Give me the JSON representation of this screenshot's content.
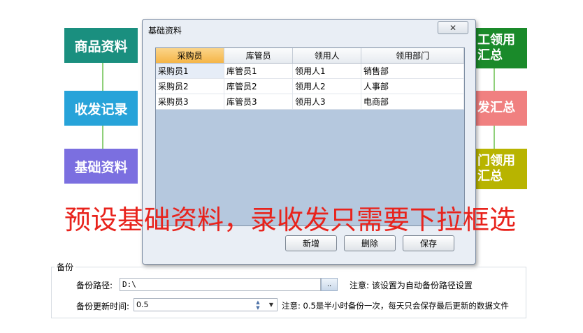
{
  "flow_left": [
    {
      "label": "商品资料",
      "color": "#1a8f7f"
    },
    {
      "label": "收发记录",
      "color": "#27a3d9"
    },
    {
      "label": "基础资料",
      "color": "#7b6fe0"
    }
  ],
  "flow_right": [
    {
      "label": "工领用\n汇总",
      "color": "#1a8a2a"
    },
    {
      "label": "发汇总",
      "color": "#f08080"
    },
    {
      "label": "门领用\n汇总",
      "color": "#b8b400"
    }
  ],
  "dialog": {
    "title": "基础资料",
    "columns": [
      "采购员",
      "库管员",
      "领用人",
      "领用部门"
    ],
    "rows": [
      [
        "采购员1",
        "库管员1",
        "领用人1",
        "销售部"
      ],
      [
        "采购员2",
        "库管员2",
        "领用人2",
        "人事部"
      ],
      [
        "采购员3",
        "库管员3",
        "领用人3",
        "电商部"
      ]
    ],
    "buttons": {
      "add": "新增",
      "delete": "删除",
      "save": "保存"
    }
  },
  "overlay_text": "预设基础资料，录收发只需要下拉框选",
  "backup": {
    "legend": "备份",
    "path_label": "备份路径:",
    "path_value": "D:\\",
    "browse_label": "..",
    "path_note": "注意: 该设置为自动备份路径设置",
    "interval_label": "备份更新时间:",
    "interval_value": "0.5",
    "interval_note": "注意: 0.5是半小时备份一次，每天只会保存最后更新的数据文件"
  }
}
